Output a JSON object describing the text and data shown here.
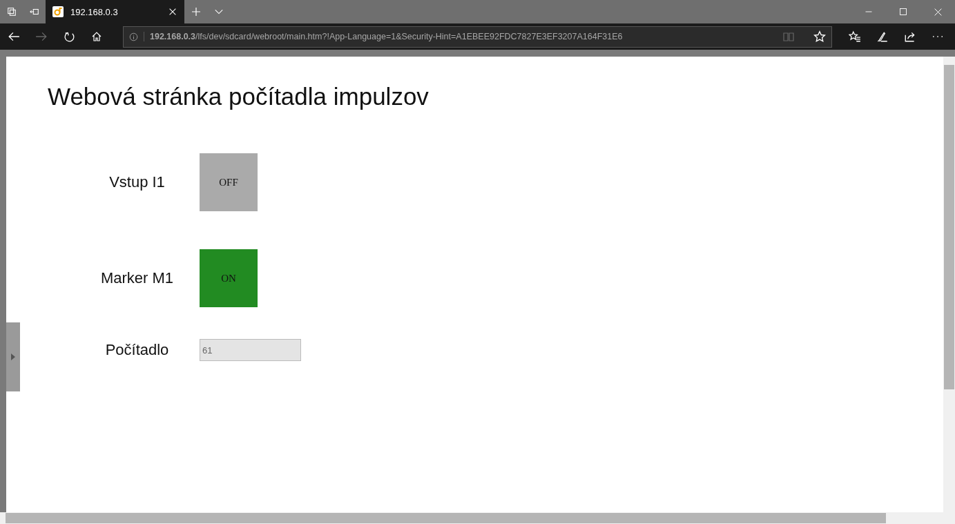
{
  "browser": {
    "tab": {
      "title": "192.168.0.3",
      "selected": true
    },
    "address": "**192.168.0.3**/lfs/dev/sdcard/webroot/main.htm?!App-Language=1&Security-Hint=A1EBEE92FDC7827E3EF3207A164F31E6"
  },
  "page": {
    "title": "Webová stránka počítadla impulzov",
    "rows": [
      {
        "kind": "indicator",
        "label": "Vstup I1",
        "text": "OFF",
        "on": false
      },
      {
        "kind": "indicator",
        "label": "Marker M1",
        "text": "ON",
        "on": true
      },
      {
        "kind": "field",
        "label": "Počítadlo",
        "value": "61"
      }
    ]
  }
}
